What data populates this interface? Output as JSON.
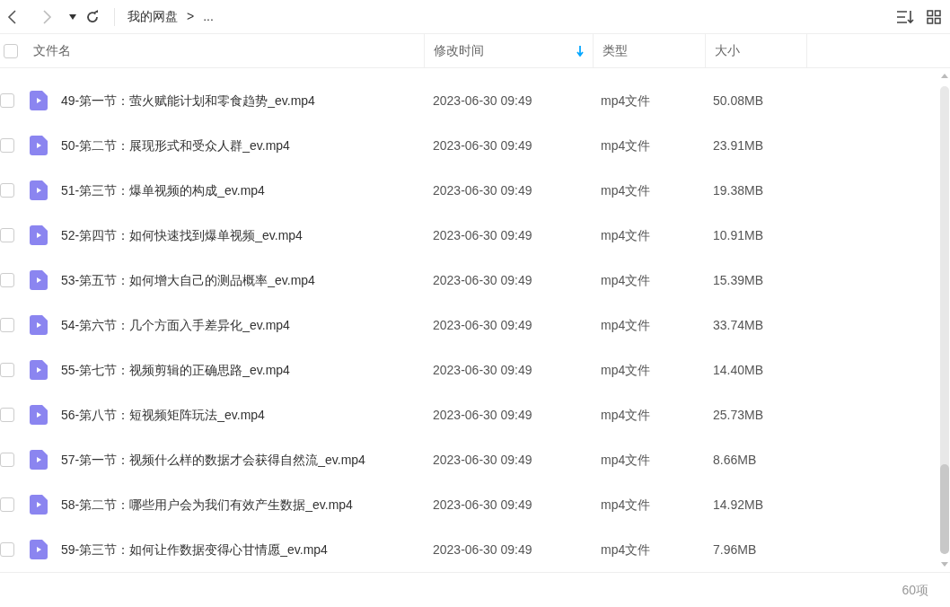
{
  "toolbar": {
    "breadcrumb": [
      "我的网盘",
      "..."
    ],
    "separator": ">"
  },
  "table": {
    "select_all": {
      "checked": false
    },
    "columns": [
      {
        "label": "文件名",
        "sorted": false
      },
      {
        "label": "修改时间",
        "sorted": true
      },
      {
        "label": "类型",
        "sorted": false
      },
      {
        "label": "大小",
        "sorted": false
      }
    ],
    "rows": [
      {
        "checked": false,
        "name": "49-第一节：萤火赋能计划和零食趋势_ev.mp4",
        "modified": "2023-06-30 09:49",
        "type": "mp4文件",
        "size": "50.08MB"
      },
      {
        "checked": false,
        "name": "50-第二节：展现形式和受众人群_ev.mp4",
        "modified": "2023-06-30 09:49",
        "type": "mp4文件",
        "size": "23.91MB"
      },
      {
        "checked": false,
        "name": "51-第三节：爆单视频的构成_ev.mp4",
        "modified": "2023-06-30 09:49",
        "type": "mp4文件",
        "size": "19.38MB"
      },
      {
        "checked": false,
        "name": "52-第四节：如何快速找到爆单视频_ev.mp4",
        "modified": "2023-06-30 09:49",
        "type": "mp4文件",
        "size": "10.91MB"
      },
      {
        "checked": false,
        "name": "53-第五节：如何增大自己的测品概率_ev.mp4",
        "modified": "2023-06-30 09:49",
        "type": "mp4文件",
        "size": "15.39MB"
      },
      {
        "checked": false,
        "name": "54-第六节：几个方面入手差异化_ev.mp4",
        "modified": "2023-06-30 09:49",
        "type": "mp4文件",
        "size": "33.74MB"
      },
      {
        "checked": false,
        "name": "55-第七节：视频剪辑的正确思路_ev.mp4",
        "modified": "2023-06-30 09:49",
        "type": "mp4文件",
        "size": "14.40MB"
      },
      {
        "checked": false,
        "name": "56-第八节：短视频矩阵玩法_ev.mp4",
        "modified": "2023-06-30 09:49",
        "type": "mp4文件",
        "size": "25.73MB"
      },
      {
        "checked": false,
        "name": "57-第一节：视频什么样的数据才会获得自然流_ev.mp4",
        "modified": "2023-06-30 09:49",
        "type": "mp4文件",
        "size": "8.66MB"
      },
      {
        "checked": false,
        "name": "58-第二节：哪些用户会为我们有效产生数据_ev.mp4",
        "modified": "2023-06-30 09:49",
        "type": "mp4文件",
        "size": "14.92MB"
      },
      {
        "checked": false,
        "name": "59-第三节：如何让作数据变得心甘情愿_ev.mp4",
        "modified": "2023-06-30 09:49",
        "type": "mp4文件",
        "size": "7.96MB"
      }
    ]
  },
  "status_bar": {
    "count": "60项"
  }
}
